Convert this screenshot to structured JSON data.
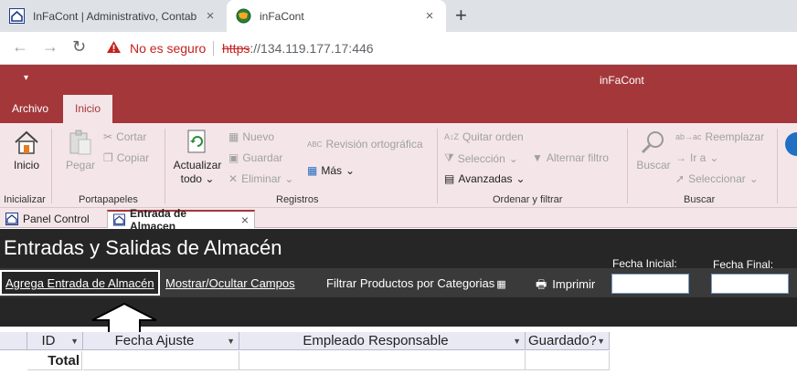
{
  "browser": {
    "tabs": [
      {
        "title": "InFaCont | Administrativo, Contab"
      },
      {
        "title": "inFaCont"
      }
    ],
    "new_tab": "+",
    "close_glyph": "×",
    "security_label": "No es seguro",
    "url_protocol": "https",
    "url_rest": "://134.119.177.17:446"
  },
  "app": {
    "title": "inFaCont",
    "qat_glyph": "▾",
    "ribbon_tabs": [
      "Archivo",
      "Inicio"
    ]
  },
  "ribbon": {
    "inicio": "Inicio",
    "pegar": "Pegar",
    "cortar": "Cortar",
    "copiar": "Copiar",
    "actualizar": "Actualizar",
    "todo": "todo",
    "nuevo": "Nuevo",
    "guardar": "Guardar",
    "eliminar": "Eliminar",
    "revision": "Revisión ortográfica",
    "mas": "Más",
    "quitar_orden": "Quitar orden",
    "seleccion": "Selección",
    "alternar_filtro": "Alternar filtro",
    "avanzadas": "Avanzadas",
    "buscar": "Buscar",
    "reemplazar": "Reemplazar",
    "ir_a": "Ir a",
    "seleccionar": "Seleccionar",
    "groups": [
      "Inicializar",
      "Portapapeles",
      "Registros",
      "Ordenar y filtrar",
      "Buscar"
    ]
  },
  "doc_tabs": [
    "Panel Control",
    "Entrada de Almacen"
  ],
  "form": {
    "title": "Entradas y Salidas de Almacén",
    "fecha_inicial_label": "Fecha Inicial:",
    "fecha_final_label": "Fecha Final:",
    "fecha_inicial_value": "",
    "fecha_final_value": "",
    "commands": {
      "agrega_entrada": "Agrega Entrada de Almacén",
      "mostrar_ocultar": "Mostrar/Ocultar Campos",
      "filtrar": "Filtrar Productos por Categorias",
      "imprimir": "Imprimir"
    }
  },
  "datasheet": {
    "columns": [
      "ID",
      "Fecha Ajuste",
      "Empleado Responsable",
      "Guardado?"
    ],
    "total_label": "Total"
  },
  "colors": {
    "access_accent": "#a4373a",
    "ribbon_bg": "#f4e6e8",
    "form_header": "#262626",
    "insecure_red": "#c5221f"
  }
}
